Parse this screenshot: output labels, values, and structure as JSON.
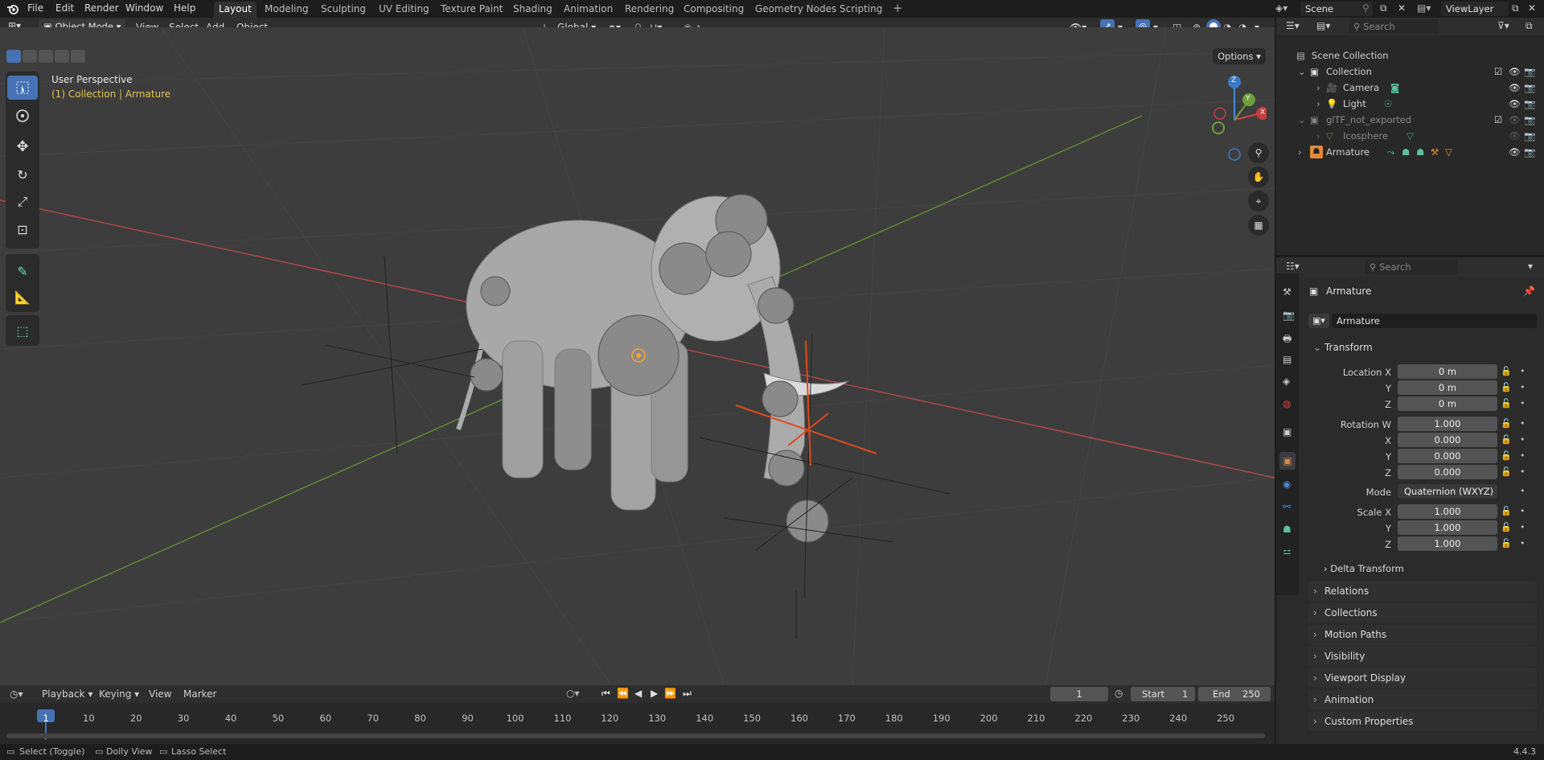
{
  "app": {
    "name": "Blender",
    "version": "4.4.3"
  },
  "menu": [
    "File",
    "Edit",
    "Render",
    "Window",
    "Help"
  ],
  "workspaces": {
    "tabs": [
      "Layout",
      "Modeling",
      "Sculpting",
      "UV Editing",
      "Texture Paint",
      "Shading",
      "Animation",
      "Rendering",
      "Compositing",
      "Geometry Nodes",
      "Scripting"
    ],
    "active": "Layout"
  },
  "scene": {
    "scene_name": "Scene",
    "view_layer": "ViewLayer"
  },
  "viewport_header": {
    "mode": "Object Mode",
    "menus": [
      "View",
      "Select",
      "Add",
      "Object"
    ],
    "transform_orientation": "Global",
    "options_label": "Options"
  },
  "viewport": {
    "perspective_label": "User Perspective",
    "context_label": "(1) Collection | Armature",
    "gizmo_axes": {
      "z": "Z",
      "y": "Y",
      "x": "X"
    }
  },
  "outliner": {
    "search_placeholder": "Search",
    "items": [
      {
        "label": "Scene Collection"
      },
      {
        "label": "Collection"
      },
      {
        "label": "Camera"
      },
      {
        "label": "Light"
      },
      {
        "label": "glTF_not_exported"
      },
      {
        "label": "Icosphere"
      },
      {
        "label": "Armature"
      }
    ]
  },
  "properties": {
    "search_placeholder": "Search",
    "object_name": "Armature",
    "object_field": "Armature",
    "transform": {
      "title": "Transform",
      "location_label": "Location X",
      "location": [
        "0 m",
        "0 m",
        "0 m"
      ],
      "rotation_label": "Rotation W",
      "rotation": [
        "1.000",
        "0.000",
        "0.000",
        "0.000"
      ],
      "mode_label": "Mode",
      "mode_value": "Quaternion (WXYZ)",
      "scale_label": "Scale X",
      "scale": [
        "1.000",
        "1.000",
        "1.000"
      ],
      "axis_labels": [
        "X",
        "Y",
        "Z"
      ],
      "delta": "Delta Transform"
    },
    "panels": [
      "Relations",
      "Collections",
      "Motion Paths",
      "Visibility",
      "Viewport Display",
      "Animation",
      "Custom Properties"
    ]
  },
  "timeline": {
    "menus": [
      "Playback",
      "Keying",
      "View",
      "Marker"
    ],
    "current_frame": "1",
    "start_label": "Start",
    "start": "1",
    "end_label": "End",
    "end": "250",
    "ruler": [
      "1",
      "10",
      "20",
      "30",
      "40",
      "50",
      "60",
      "70",
      "80",
      "90",
      "100",
      "110",
      "120",
      "130",
      "140",
      "150",
      "160",
      "170",
      "180",
      "190",
      "200",
      "210",
      "220",
      "230",
      "240",
      "250"
    ]
  },
  "statusbar": {
    "items": [
      "Select (Toggle)",
      "Dolly View",
      "Lasso Select"
    ],
    "version": "4.4.3"
  },
  "colors": {
    "accent": "#4772b3",
    "x_axis": "#c43c3c",
    "y_axis": "#6ea03b",
    "selection": "#f5a623"
  }
}
